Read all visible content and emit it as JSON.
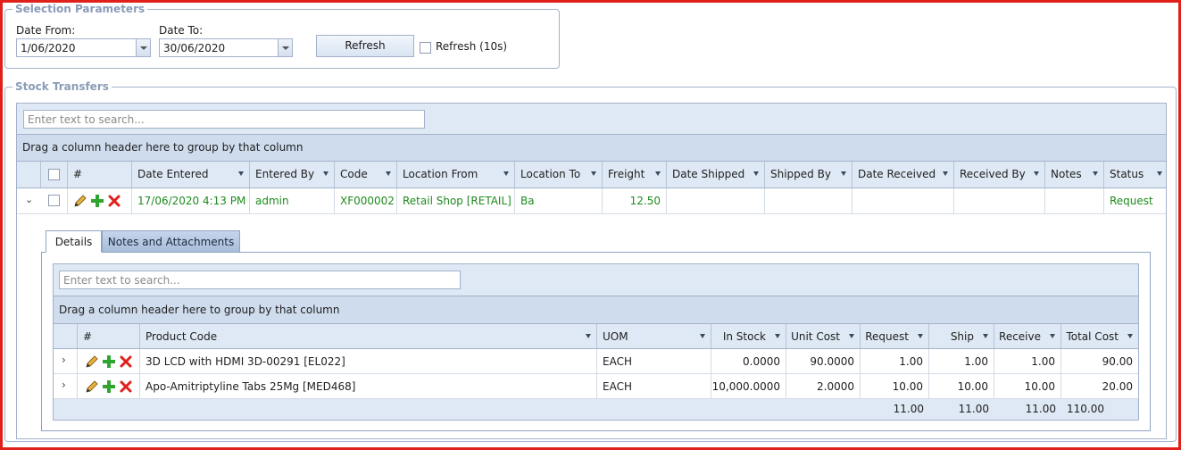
{
  "selection": {
    "legend": "Selection Parameters",
    "date_from_label": "Date From:",
    "date_from_value": "1/06/2020",
    "date_to_label": "Date To:",
    "date_to_value": "30/06/2020",
    "refresh_label": "Refresh",
    "auto_refresh_label": "Refresh (10s)"
  },
  "stock": {
    "legend": "Stock Transfers",
    "search_placeholder": "Enter text to search...",
    "group_hint": "Drag a column header here to group by that column",
    "columns": [
      "#",
      "Date Entered",
      "Entered By",
      "Code",
      "Location From",
      "Location To",
      "Freight",
      "Date Shipped",
      "Shipped By",
      "Date Received",
      "Received By",
      "Notes",
      "Status"
    ],
    "row": {
      "date_entered": "17/06/2020 4:13 PM",
      "entered_by": "admin",
      "code": "XF000002",
      "location_from": "Retail Shop [RETAIL]",
      "location_to": "Ba",
      "freight": "12.50",
      "date_shipped": "",
      "shipped_by": "",
      "date_received": "",
      "received_by": "",
      "notes": "",
      "status": "Request"
    }
  },
  "detail": {
    "tabs": [
      "Details",
      "Notes and Attachments"
    ],
    "search_placeholder": "Enter text to search...",
    "group_hint": "Drag a column header here to group by that column",
    "columns": [
      "#",
      "Product Code",
      "UOM",
      "In Stock",
      "Unit Cost",
      "Request",
      "Ship",
      "Receive",
      "Total Cost"
    ],
    "rows": [
      {
        "product": "3D LCD with HDMI 3D-00291 [EL022]",
        "uom": "EACH",
        "in_stock": "0.0000",
        "unit_cost": "90.0000",
        "request": "1.00",
        "ship": "1.00",
        "receive": "1.00",
        "total": "90.00"
      },
      {
        "product": "Apo-Amitriptyline Tabs 25Mg [MED468]",
        "uom": "EACH",
        "in_stock": "10,000.0000",
        "unit_cost": "2.0000",
        "request": "10.00",
        "ship": "10.00",
        "receive": "10.00",
        "total": "20.00"
      }
    ],
    "totals": {
      "request": "11.00",
      "ship": "11.00",
      "receive": "11.00",
      "total": "110.00"
    }
  },
  "colors": {
    "frame": "#e0201a",
    "accent": "#8a9cb8",
    "green_text": "#1e8a1e"
  }
}
